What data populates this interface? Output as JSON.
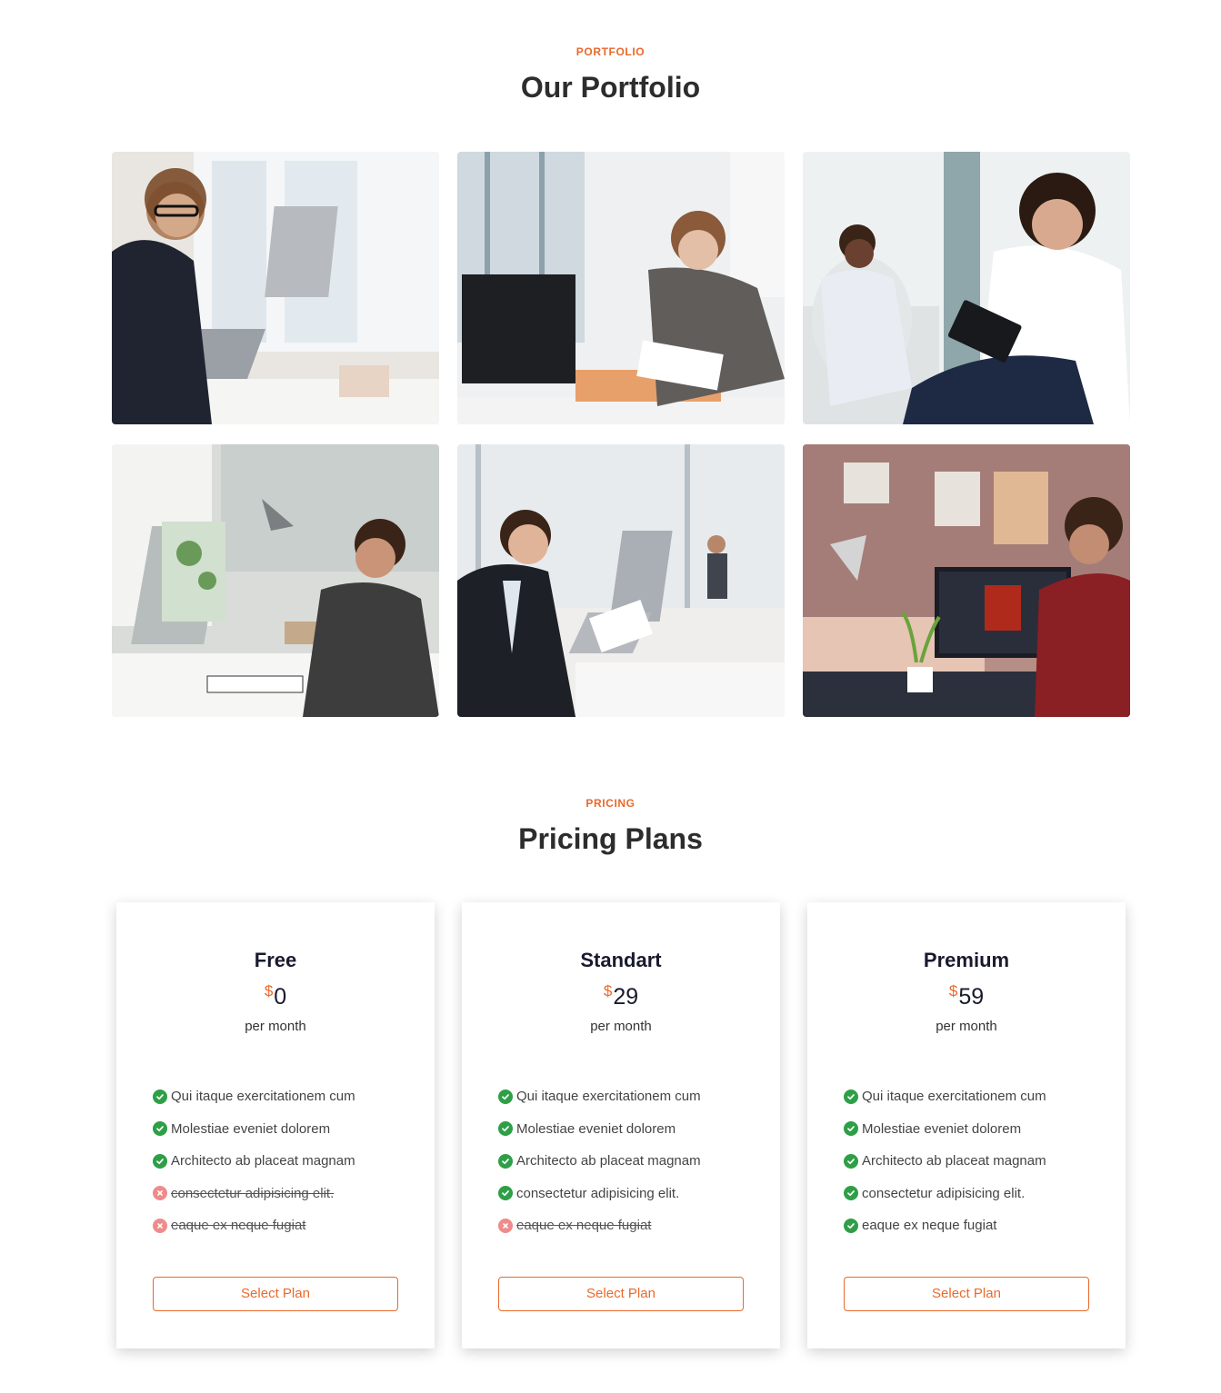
{
  "portfolio": {
    "eyebrow": "PORTFOLIO",
    "title": "Our Portfolio",
    "items": [
      {
        "subject": "man with glasses at desk with laptop and monitor"
      },
      {
        "subject": "woman working at computer with papers"
      },
      {
        "subject": "two women in lounge chairs with tablet"
      },
      {
        "subject": "man typing at desk with world map monitor"
      },
      {
        "subject": "man in suit reading documents at laptop"
      },
      {
        "subject": "bearded man in plaid shirt at computer at night"
      }
    ]
  },
  "pricing": {
    "eyebrow": "PRICING",
    "title": "Pricing Plans",
    "plans": [
      {
        "name": "Free",
        "currency": "$",
        "amount": "0",
        "period": "per month",
        "button": "Select Plan",
        "features": [
          {
            "text": "Qui itaque exercitationem cum",
            "included": true
          },
          {
            "text": "Molestiae eveniet dolorem",
            "included": true
          },
          {
            "text": "Architecto ab placeat magnam",
            "included": true
          },
          {
            "text": "consectetur adipisicing elit.",
            "included": false
          },
          {
            "text": "eaque ex neque fugiat",
            "included": false
          }
        ]
      },
      {
        "name": "Standart",
        "currency": "$",
        "amount": "29",
        "period": "per month",
        "button": "Select Plan",
        "features": [
          {
            "text": "Qui itaque exercitationem cum",
            "included": true
          },
          {
            "text": "Molestiae eveniet dolorem",
            "included": true
          },
          {
            "text": "Architecto ab placeat magnam",
            "included": true
          },
          {
            "text": "consectetur adipisicing elit.",
            "included": true
          },
          {
            "text": "eaque ex neque fugiat",
            "included": false
          }
        ]
      },
      {
        "name": "Premium",
        "currency": "$",
        "amount": "59",
        "period": "per month",
        "button": "Select Plan",
        "features": [
          {
            "text": "Qui itaque exercitationem cum",
            "included": true
          },
          {
            "text": "Molestiae eveniet dolorem",
            "included": true
          },
          {
            "text": "Architecto ab placeat magnam",
            "included": true
          },
          {
            "text": "consectetur adipisicing elit.",
            "included": true
          },
          {
            "text": "eaque ex neque fugiat",
            "included": true
          }
        ]
      }
    ]
  },
  "colors": {
    "accent": "#e9692c",
    "check": "#2e9f47",
    "cross": "#f08b8b"
  }
}
